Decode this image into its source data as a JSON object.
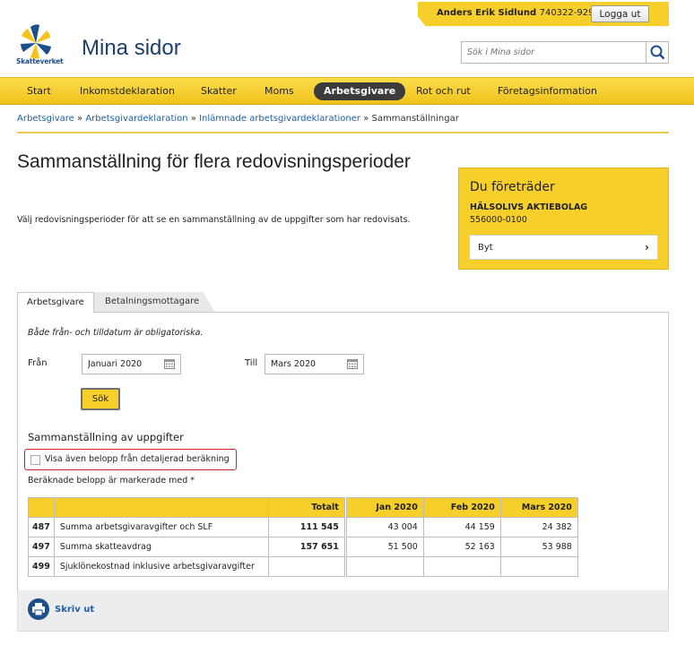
{
  "user": {
    "name": "Anders Erik Sidlund",
    "id": "740322-9292",
    "logout_label": "Logga ut"
  },
  "logo": {
    "text": "Skatteverket"
  },
  "site_title": "Mina sidor",
  "search": {
    "placeholder": "Sök i Mina sidor"
  },
  "nav": [
    {
      "label": "Start"
    },
    {
      "label": "Inkomstdeklaration"
    },
    {
      "label": "Skatter"
    },
    {
      "label": "Moms"
    },
    {
      "label": "Arbetsgivare"
    },
    {
      "label": "Rot och rut"
    },
    {
      "label": "Företagsinformation"
    }
  ],
  "nav_active": "Arbetsgivare",
  "breadcrumb": {
    "links": [
      "Arbetsgivare",
      "Arbetsgivardeklaration",
      "Inlämnade arbetsgivardeklarationer"
    ],
    "current": "Sammanställningar",
    "separator": "»"
  },
  "page": {
    "title": "Sammanställning för flera redovisningsperioder",
    "description": "Välj redovisningsperioder för att se en sammanställning av de uppgifter som har redovisats."
  },
  "represent": {
    "title": "Du företräder",
    "company": "HÄLSOLIVS AKTIEBOLAG",
    "org_nr": "556000-0100",
    "change_label": "Byt"
  },
  "tabs": [
    {
      "label": "Arbetsgivare"
    },
    {
      "label": "Betalningsmottagare"
    }
  ],
  "form": {
    "hint": "Både från- och tilldatum är obligatoriska.",
    "from_label": "Från",
    "from_value": "Januari 2020",
    "to_label": "Till",
    "to_value": "Mars 2020",
    "submit_label": "Sök"
  },
  "summary": {
    "title": "Sammanställning av uppgifter",
    "checkbox_label": "Visa även belopp från detaljerad beräkning",
    "checkbox_checked": false,
    "note": "Beräknade belopp är markerade med *",
    "headers": {
      "total": "Totalt",
      "months": [
        "Jan 2020",
        "Feb 2020",
        "Mars 2020"
      ]
    },
    "rows": [
      {
        "code": "487",
        "desc": "Summa arbetsgivaravgifter och SLF",
        "total": "111 545",
        "months": [
          "43 004",
          "44 159",
          "24 382"
        ]
      },
      {
        "code": "497",
        "desc": "Summa skatteavdrag",
        "total": "157 651",
        "months": [
          "51 500",
          "52 163",
          "53 988"
        ]
      },
      {
        "code": "499",
        "desc": "Sjuklönekostnad inklusive arbetsgivaravgifter",
        "total": "",
        "months": [
          "",
          "",
          ""
        ]
      }
    ]
  },
  "print_label": "Skriv ut",
  "colors": {
    "accent_yellow": "#f6cf2a",
    "nav_dark": "#3b3b3b",
    "link_blue": "#1e5fa8",
    "title_blue": "#1d3e6d",
    "highlight_red": "#d6222a"
  }
}
